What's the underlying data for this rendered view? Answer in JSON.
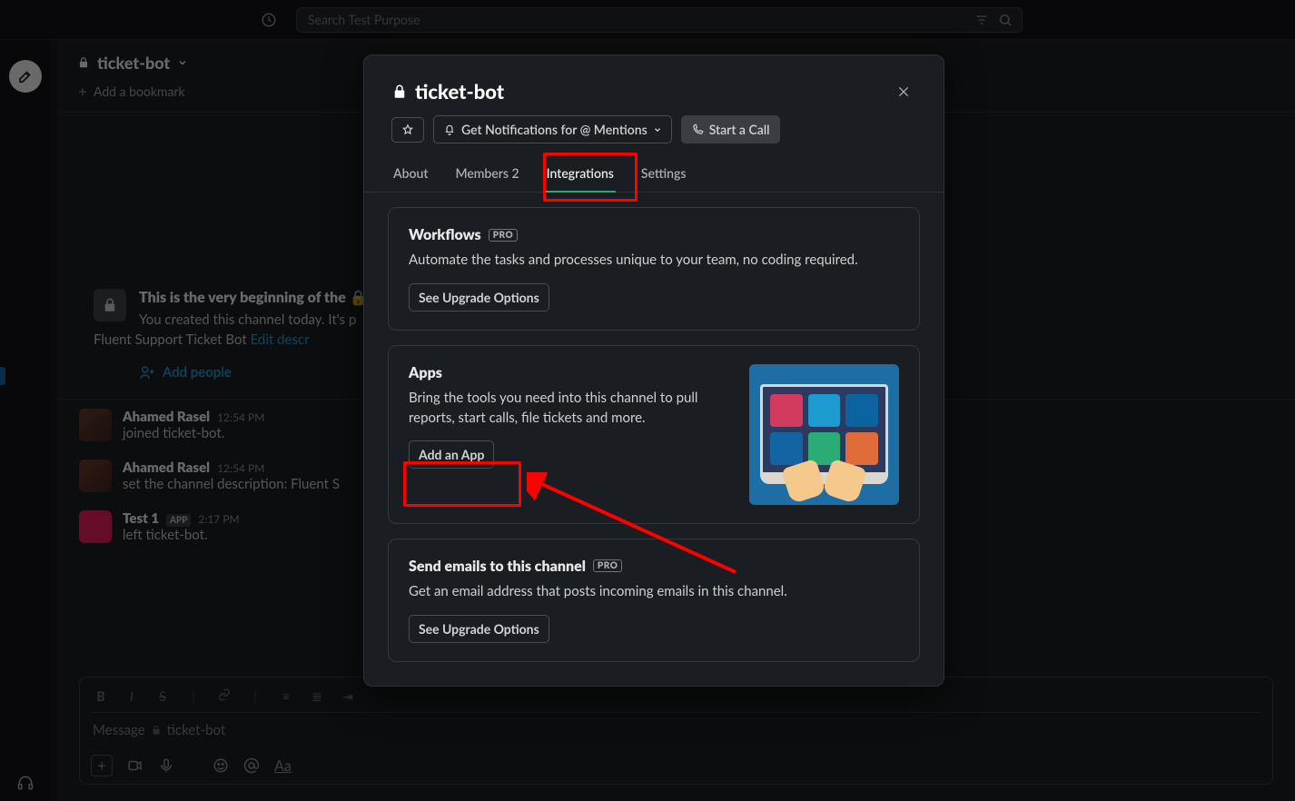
{
  "search": {
    "placeholder": "Search Test Purpose"
  },
  "channel": {
    "name": "ticket-bot",
    "add_bookmark": "Add a bookmark",
    "intro_title_prefix": "This is the very beginning of the ",
    "intro_desc_line1": "You created this channel today. It's p",
    "intro_desc_line2_prefix": "Fluent Support Ticket Bot ",
    "intro_edit_link": "Edit descr",
    "add_people": "Add people",
    "compose_placeholder_prefix": "Message ",
    "compose_channel": "ticket-bot"
  },
  "messages": [
    {
      "name": "Ahamed Rasel",
      "time": "12:54 PM",
      "body": "joined ticket-bot."
    },
    {
      "name": "Ahamed Rasel",
      "time": "12:54 PM",
      "body": "set the channel description: Fluent S"
    },
    {
      "name": "Test 1",
      "badge": "APP",
      "time": "2:17 PM",
      "body": "left ticket-bot."
    }
  ],
  "modal": {
    "title": "ticket-bot",
    "notifications_btn": "Get Notifications for @ Mentions",
    "start_call": "Start a Call",
    "tabs": {
      "about": "About",
      "members": "Members 2",
      "integrations": "Integrations",
      "settings": "Settings"
    },
    "workflows": {
      "title": "Workflows",
      "pro": "PRO",
      "desc": "Automate the tasks and processes unique to your team, no coding required.",
      "btn": "See Upgrade Options"
    },
    "apps": {
      "title": "Apps",
      "desc": "Bring the tools you need into this channel to pull reports, start calls, file tickets and more.",
      "btn": "Add an App"
    },
    "emails": {
      "title": "Send emails to this channel",
      "pro": "PRO",
      "desc": "Get an email address that posts incoming emails in this channel.",
      "btn": "See Upgrade Options"
    }
  }
}
